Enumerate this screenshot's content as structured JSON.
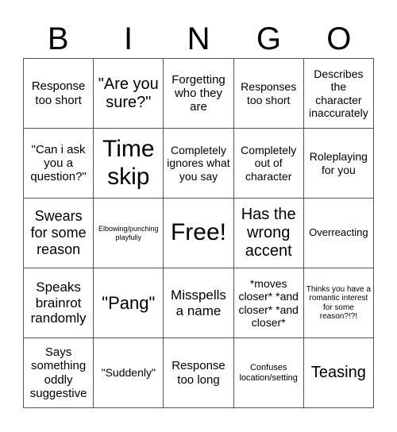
{
  "title_letters": [
    "B",
    "I",
    "N",
    "G",
    "O"
  ],
  "cells": [
    [
      "Response too short",
      "\"Are you sure?\"",
      "Forgetting who they are",
      "Responses too short",
      "Describes the character inaccurately"
    ],
    [
      "\"Can i ask you a question?\"",
      "Time skip",
      "Completely ignores what you say",
      "Completely out of character",
      "Roleplaying for you"
    ],
    [
      "Swears for some reason",
      "Elbowing/punching playfully",
      "Free!",
      "Has the wrong accent",
      "Overreacting"
    ],
    [
      "Speaks brainrot randomly",
      "\"Pang\"",
      "Misspells a name",
      "*moves closer* *and closer* *and closer*",
      "Thinks you have a romantic interest for some reason?!?!"
    ],
    [
      "Says something oddly suggestive",
      "\"Suddenly\"",
      "Response too long",
      "Confuses location/setting",
      "Teasing"
    ]
  ]
}
